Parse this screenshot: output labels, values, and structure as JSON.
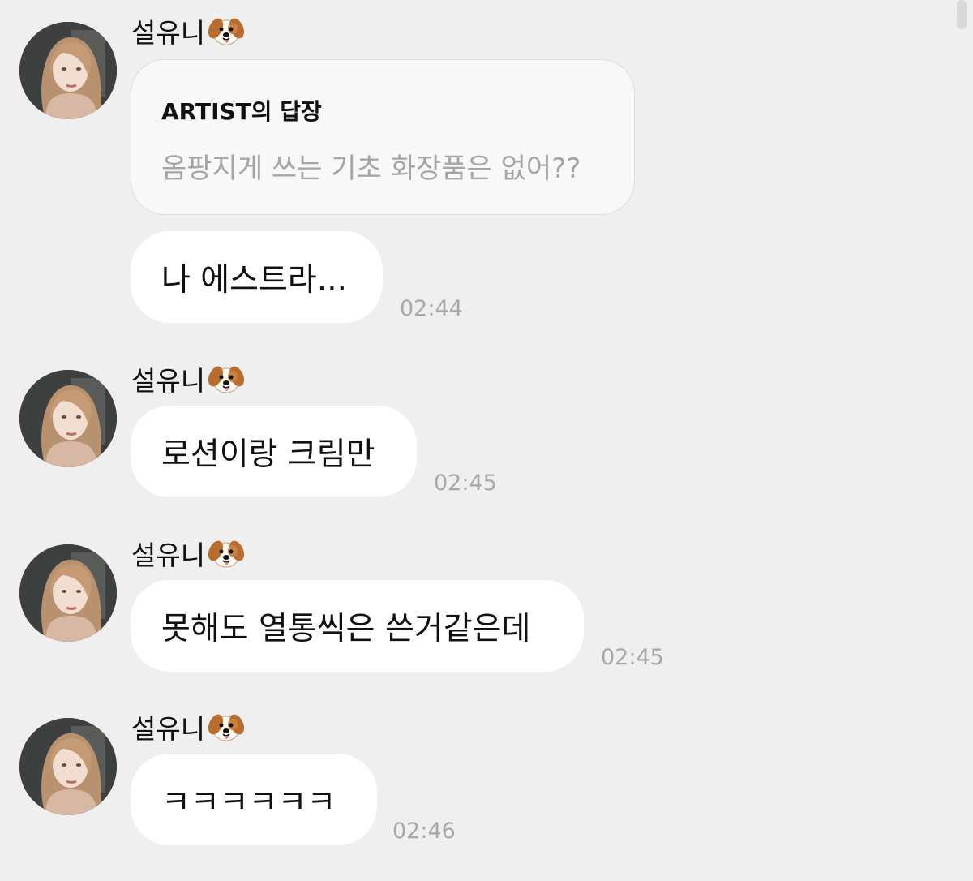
{
  "colors": {
    "background": "#efefef",
    "bubble": "#ffffff",
    "reply_card": "#f8f8f8",
    "reply_text": "#a5a5a5",
    "timestamp": "#a8a8a8"
  },
  "messages": [
    {
      "sender": "설유니",
      "sender_icon": "dog-face-icon",
      "reply": {
        "title": "ARTIST의 답장",
        "quote": "옴팡지게 쓰는 기초 화장품은 없어??"
      },
      "text": "나 에스트라...",
      "time": "02:44"
    },
    {
      "sender": "설유니",
      "sender_icon": "dog-face-icon",
      "text": "로션이랑 크림만",
      "time": "02:45"
    },
    {
      "sender": "설유니",
      "sender_icon": "dog-face-icon",
      "text": "못해도 열통씩은 쓴거같은데",
      "time": "02:45"
    },
    {
      "sender": "설유니",
      "sender_icon": "dog-face-icon",
      "text": "ㅋㅋㅋㅋㅋㅋ",
      "time": "02:46"
    }
  ]
}
